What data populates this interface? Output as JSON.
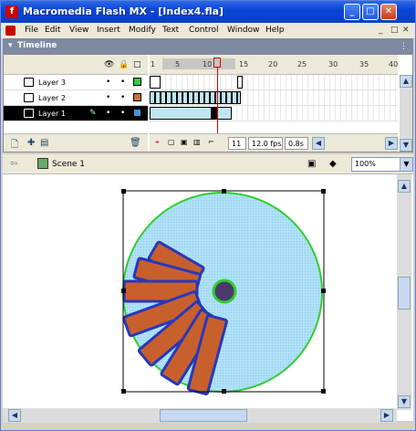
{
  "window": {
    "title": "Macromedia Flash MX - [Index4.fla]"
  },
  "titlebar_buttons": {
    "minimize": "_",
    "maximize": "□",
    "close": "✕"
  },
  "menu": [
    "File",
    "Edit",
    "View",
    "Insert",
    "Modify",
    "Text",
    "Control",
    "Window",
    "Help"
  ],
  "mdi_controls": [
    "_",
    "□",
    "✕"
  ],
  "panel": {
    "title": "Timeline",
    "arrow": "▾",
    "grip": "⋮"
  },
  "timeline_header_icons": {
    "eye": "👁",
    "lock": "🔒",
    "outline": "□"
  },
  "layers": [
    {
      "name": "Layer 3",
      "color": "#2ecc40",
      "selected": false
    },
    {
      "name": "Layer 2",
      "color": "#c87038",
      "selected": false
    },
    {
      "name": "Layer 1",
      "color": "#4a90d9",
      "selected": true
    }
  ],
  "layer_dot": "•",
  "frame_ruler": [
    "1",
    "5",
    "10",
    "15",
    "20",
    "25",
    "30",
    "35",
    "40"
  ],
  "frame_status": {
    "current_frame": "11",
    "fps": "12.0 fps",
    "time": "0.8s"
  },
  "edit_bar": {
    "scene": "Scene 1",
    "zoom": "100%"
  },
  "icons": {
    "back": "⇦",
    "add_layer": "🗋",
    "trash": "🗑",
    "edit_symbols": "◆",
    "edit_scene": "▣",
    "chevron": "▼",
    "up": "▲",
    "down": "▼",
    "left": "◀",
    "right": "▶"
  },
  "stage": {
    "circle_fill": "#aee0f7",
    "circle_stroke": "#33cc33",
    "rect_fill": "#c8602e",
    "rect_stroke": "#2838b8",
    "center_fill": "#4a3a6a"
  }
}
